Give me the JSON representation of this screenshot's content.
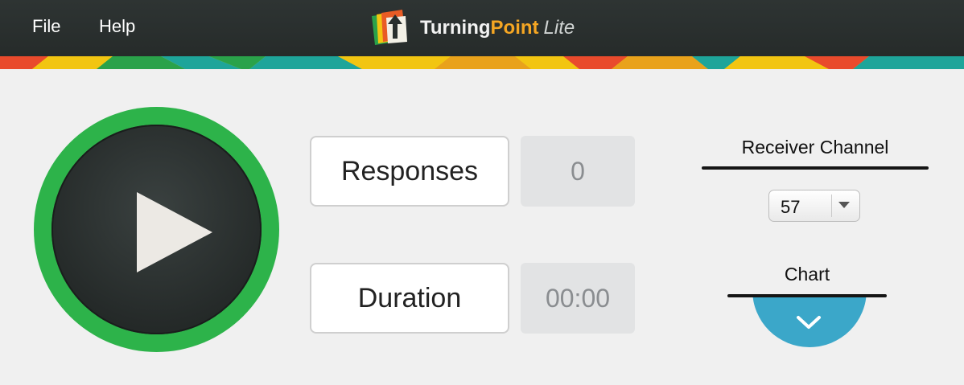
{
  "menu": {
    "file_label": "File",
    "help_label": "Help"
  },
  "brand": {
    "turning": "Turning",
    "point": "Point",
    "lite": "Lite",
    "logo_icon": "turningpoint-logo-icon"
  },
  "play": {
    "icon": "play-icon",
    "ring_color": "#2db34a"
  },
  "stats": {
    "responses_label": "Responses",
    "responses_value": "0",
    "duration_label": "Duration",
    "duration_value": "00:00"
  },
  "receiver": {
    "label": "Receiver Channel",
    "selected": "57",
    "dropdown_icon": "caret-down-icon"
  },
  "chart": {
    "label": "Chart",
    "toggle_icon": "chevron-down-icon",
    "accent": "#3ba7c9"
  },
  "colors": {
    "topbar": "#2a2f2e",
    "background": "#f0f0f0",
    "brand_orange": "#f5a623"
  }
}
